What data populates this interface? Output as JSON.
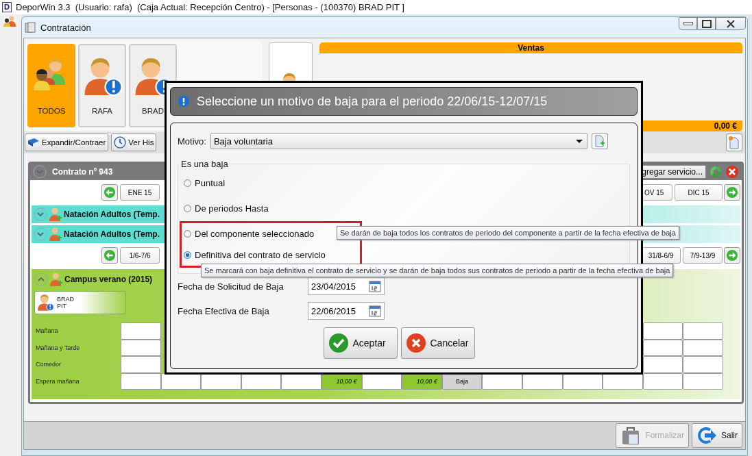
{
  "os_window": {
    "logo": "D",
    "title": "DeporWin 3.3  (Usuario: rafa)  (Caja Actual: Recepción Centro) - [Personas - (100370) BRAD PIT ]"
  },
  "window": {
    "title": "Contratación"
  },
  "people": [
    {
      "label": "TODOS",
      "kind": "group",
      "selected": true
    },
    {
      "label": "RAFA",
      "kind": "person",
      "selected": false
    },
    {
      "label": "BRAD",
      "kind": "person",
      "selected": false
    }
  ],
  "ventas": {
    "title": "Ventas",
    "total": "0,00 €"
  },
  "toolbar": [
    {
      "label": "Expandir/Contraer",
      "kind": "book"
    },
    {
      "label": "Ver His",
      "kind": "clock"
    }
  ],
  "contract": {
    "title": "Contrato nº 943",
    "add_button": "gregar servicio...",
    "months": {
      "left": [
        "ENE 15"
      ],
      "right": [
        "OV 15",
        "DIC 15"
      ]
    },
    "services": [
      {
        "name": "Natación Adultos (Temp.",
        "expanded": false
      },
      {
        "name": "Natación Adultos (Temp.",
        "expanded": false
      }
    ],
    "weeks": {
      "left": [
        "1/6-7/6"
      ],
      "right": [
        "31/8-6/9",
        "7/9-13/9"
      ]
    },
    "campus": {
      "name": "Campus verano (2015)",
      "expanded": true,
      "person": [
        "BRAD",
        "PIT"
      ],
      "rows": [
        {
          "label": "Mañana",
          "cells": [
            {
              "kind": "empty"
            },
            {
              "kind": "covered"
            },
            {
              "kind": "covered"
            },
            {
              "kind": "covered"
            },
            {
              "kind": "covered"
            },
            {
              "kind": "covered"
            },
            {
              "kind": "covered"
            },
            {
              "kind": "covered"
            },
            {
              "kind": "covered"
            },
            {
              "kind": "covered"
            },
            {
              "kind": "covered"
            },
            {
              "kind": "covered"
            },
            {
              "kind": "covered"
            },
            {
              "kind": "empty"
            },
            {
              "kind": "empty"
            }
          ]
        },
        {
          "label": "Mañana y Tarde",
          "cells": [
            {
              "kind": "empty"
            },
            {
              "kind": "covered"
            },
            {
              "kind": "covered"
            },
            {
              "kind": "covered"
            },
            {
              "kind": "covered"
            },
            {
              "kind": "covered"
            },
            {
              "kind": "covered"
            },
            {
              "kind": "covered"
            },
            {
              "kind": "covered"
            },
            {
              "kind": "covered"
            },
            {
              "kind": "covered"
            },
            {
              "kind": "covered"
            },
            {
              "kind": "covered"
            },
            {
              "kind": "empty"
            },
            {
              "kind": "empty"
            }
          ]
        },
        {
          "label": "Comedor",
          "cells": [
            {
              "kind": "empty"
            },
            {
              "kind": "covered"
            },
            {
              "kind": "covered"
            },
            {
              "kind": "covered"
            },
            {
              "kind": "covered"
            },
            {
              "kind": "covered"
            },
            {
              "kind": "covered"
            },
            {
              "kind": "covered"
            },
            {
              "kind": "covered"
            },
            {
              "kind": "covered"
            },
            {
              "kind": "covered"
            },
            {
              "kind": "covered"
            },
            {
              "kind": "covered"
            },
            {
              "kind": "empty"
            },
            {
              "kind": "empty"
            }
          ]
        },
        {
          "label": "Espera mañana",
          "cells": [
            {
              "kind": "empty"
            },
            {
              "kind": "empty"
            },
            {
              "kind": "empty"
            },
            {
              "kind": "empty"
            },
            {
              "kind": "empty"
            },
            {
              "kind": "price",
              "text": "10,00 €"
            },
            {
              "kind": "empty"
            },
            {
              "kind": "price",
              "text": "10,00 €"
            },
            {
              "kind": "baja",
              "text": "Baja"
            },
            {
              "kind": "empty"
            },
            {
              "kind": "empty"
            },
            {
              "kind": "empty"
            },
            {
              "kind": "empty"
            },
            {
              "kind": "empty"
            },
            {
              "kind": "empty"
            }
          ]
        }
      ]
    }
  },
  "footer": [
    {
      "label": "Formalizar",
      "kind": "bag",
      "disabled": true
    },
    {
      "label": "Salir",
      "kind": "exit",
      "disabled": false
    }
  ],
  "dialog": {
    "title": "Seleccione un motivo de baja para el periodo 22/06/15-12/07/15",
    "motivo_label": "Motivo:",
    "motivo_value": "Baja voluntaria",
    "group_title": "Es una baja",
    "options": [
      {
        "label": "Puntual",
        "selected": false,
        "highlighted": false
      },
      {
        "label": "De periodos Hasta",
        "selected": false,
        "highlighted": false
      },
      {
        "label": "Del componente seleccionado",
        "selected": false,
        "highlighted": true,
        "tooltip": "Se darán de baja todos los contratos de periodo del componente a partir de la fecha efectiva de baja"
      },
      {
        "label": "Definitiva del contrato de servicio",
        "selected": true,
        "highlighted": true,
        "tooltip": "Se marcará con baja definitiva el contrato de servicio y se darán de baja todos sus contratos de periodo a partir de la fecha efectiva de baja"
      }
    ],
    "dates": [
      {
        "label": "Fecha de Solicitud de Baja",
        "value": "23/04/2015"
      },
      {
        "label": "Fecha Efectiva de Baja",
        "value": "22/06/2015"
      }
    ],
    "buttons": [
      {
        "label": "Aceptar",
        "kind": "ok"
      },
      {
        "label": "Cancelar",
        "kind": "cancel"
      }
    ]
  }
}
